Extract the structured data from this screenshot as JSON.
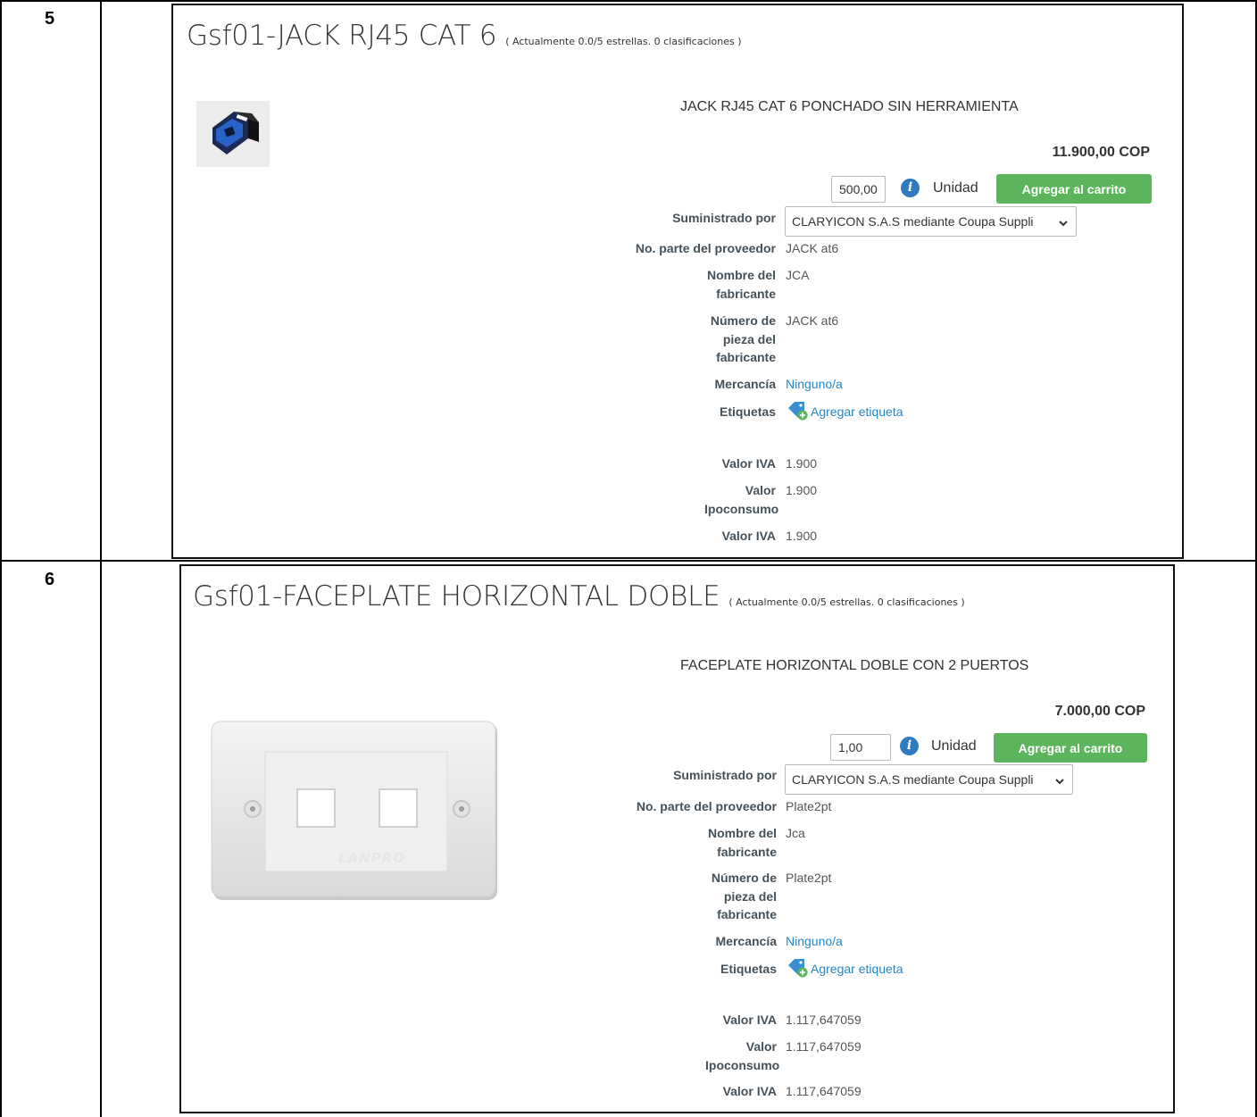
{
  "rows": [
    {
      "number": "5",
      "product": {
        "title": "Gsf01-JACK RJ45 CAT 6",
        "rating": "( Actualmente 0.0/5 estrellas. 0 clasificaciones )",
        "description": "JACK RJ45 CAT 6 PONCHADO SIN HERRAMIENTA",
        "price": "11.900,00 COP",
        "quantity": "500,00",
        "unit": "Unidad",
        "add_to_cart": "Agregar al carrito",
        "supplied_by_label": "Suministrado por",
        "supplier": "CLARYICON S.A.S mediante Coupa Suppli",
        "supplier_part_label": "No. parte del proveedor",
        "supplier_part": "JACK at6",
        "manufacturer_name_label": "Nombre del fabricante",
        "manufacturer_name": "JCA",
        "manufacturer_part_label": "Número de pieza del fabricante",
        "manufacturer_part": "JACK at6",
        "commodity_label": "Mercancía",
        "commodity": "Ninguno/a",
        "tags_label": "Etiquetas",
        "add_tag": "Agregar etiqueta",
        "iva_label": "Valor IVA",
        "iva": "1.900",
        "ipoconsumo_label": "Valor Ipoconsumo",
        "ipoconsumo": "1.900",
        "iva2_label": "Valor IVA",
        "iva2": "1.900",
        "image": "rj45-jack-image"
      }
    },
    {
      "number": "6",
      "product": {
        "title": "Gsf01-FACEPLATE HORIZONTAL DOBLE",
        "rating": "( Actualmente 0.0/5 estrellas. 0 clasificaciones )",
        "description": "FACEPLATE HORIZONTAL DOBLE CON 2 PUERTOS",
        "price": "7.000,00 COP",
        "quantity": "1,00",
        "unit": "Unidad",
        "add_to_cart": "Agregar al carrito",
        "supplied_by_label": "Suministrado por",
        "supplier": "CLARYICON S.A.S mediante Coupa Suppli",
        "supplier_part_label": "No. parte del proveedor",
        "supplier_part": "Plate2pt",
        "manufacturer_name_label": "Nombre del fabricante",
        "manufacturer_name": "Jca",
        "manufacturer_part_label": "Número de pieza del fabricante",
        "manufacturer_part": "Plate2pt",
        "commodity_label": "Mercancía",
        "commodity": "Ninguno/a",
        "tags_label": "Etiquetas",
        "add_tag": "Agregar etiqueta",
        "iva_label": "Valor IVA",
        "iva": "1.117,647059",
        "ipoconsumo_label": "Valor Ipoconsumo",
        "ipoconsumo": "1.117,647059",
        "iva2_label": "Valor IVA",
        "iva2": "1.117,647059",
        "image": "faceplate-image",
        "image_brand": "LANPRO"
      }
    }
  ],
  "colors": {
    "accent_green": "#5cb55c",
    "link_blue": "#1e88c9",
    "info_blue": "#2f7bbf"
  }
}
